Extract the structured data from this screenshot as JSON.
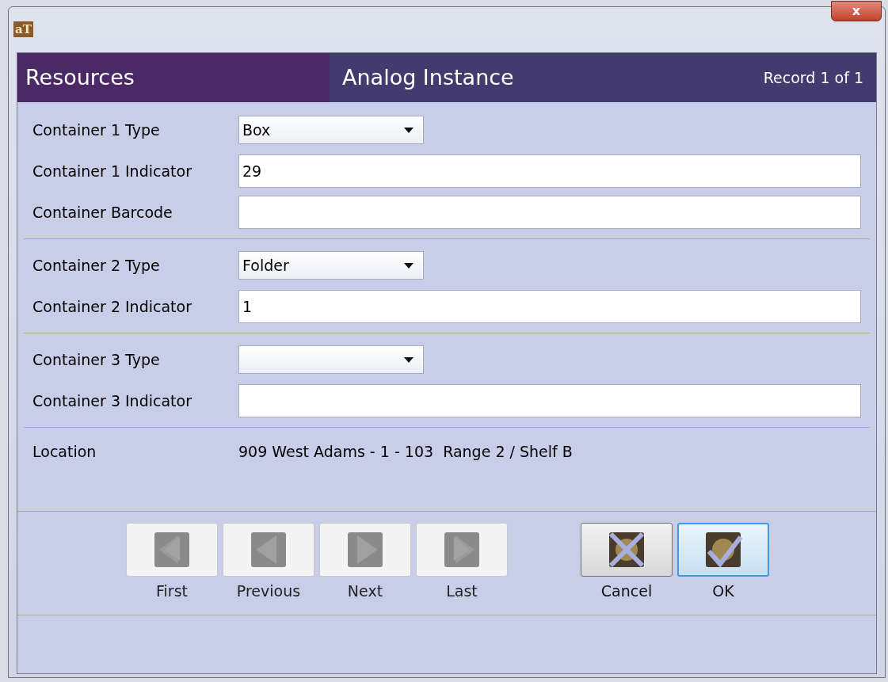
{
  "window": {
    "icon_text": "aT",
    "close": "x"
  },
  "header": {
    "module": "Resources",
    "title": "Analog Instance",
    "record": "Record 1 of 1"
  },
  "sections": [
    {
      "fields": [
        {
          "label": "Container 1 Type",
          "kind": "dropdown",
          "value": "Box"
        },
        {
          "label": "Container 1 Indicator",
          "kind": "text",
          "value": "29"
        },
        {
          "label": "Container Barcode",
          "kind": "text"
        }
      ]
    },
    {
      "fields": [
        {
          "label": "Container 2 Type",
          "kind": "dropdown",
          "value": "Folder"
        },
        {
          "label": "Container 2 Indicator",
          "kind": "text",
          "value": "1"
        }
      ]
    },
    {
      "fields": [
        {
          "label": "Container 3 Type",
          "kind": "dropdown"
        },
        {
          "label": "Container 3 Indicator",
          "kind": "text"
        }
      ]
    }
  ],
  "location": {
    "label": "Location",
    "value": "909 West Adams - 1 - 103  Range 2 / Shelf B"
  },
  "buttons": [
    {
      "label": "First",
      "kind": "first",
      "disabled": true,
      "focused": false
    },
    {
      "label": "Previous",
      "kind": "previous",
      "disabled": true,
      "focused": false
    },
    {
      "label": "Next",
      "kind": "next",
      "disabled": true,
      "focused": false
    },
    {
      "label": "Last",
      "kind": "last",
      "disabled": true,
      "focused": false
    },
    {
      "label": "Cancel",
      "kind": "cancel",
      "disabled": false,
      "focused": false
    },
    {
      "label": "OK",
      "kind": "ok",
      "disabled": false,
      "focused": true
    }
  ]
}
